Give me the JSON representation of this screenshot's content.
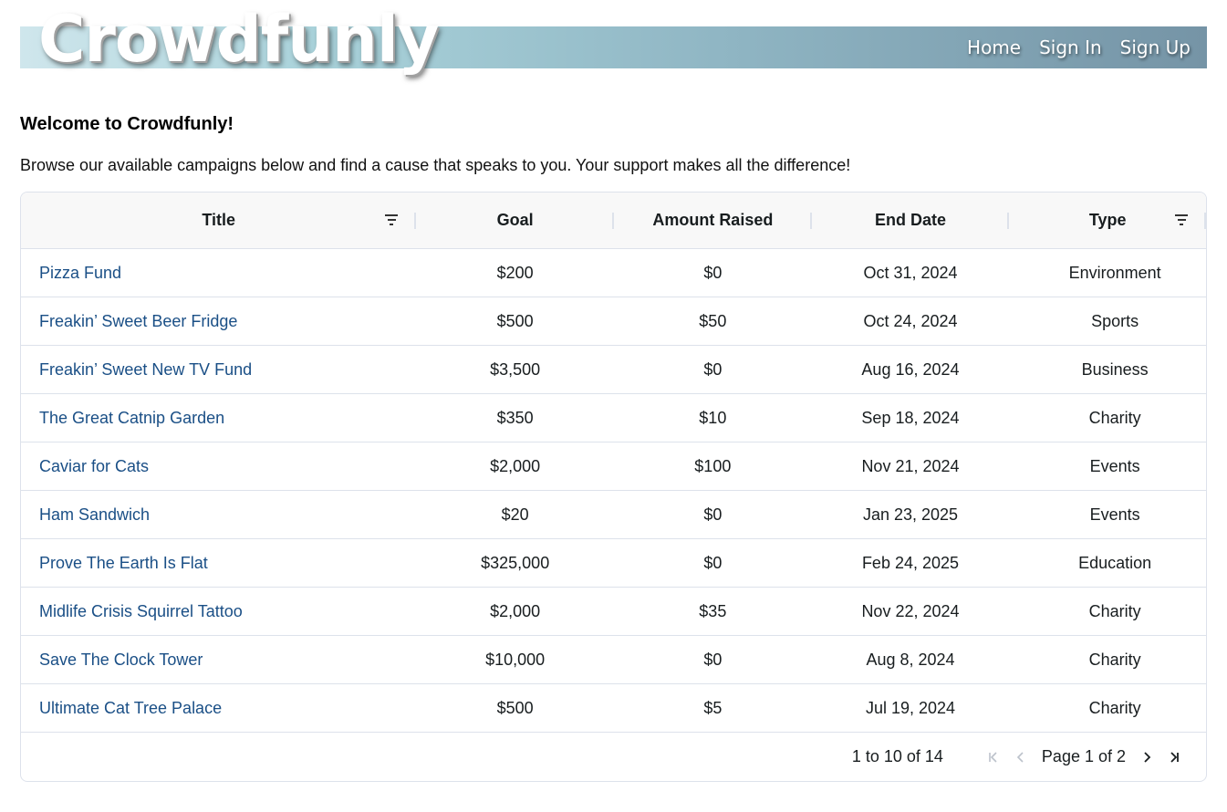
{
  "header": {
    "logo": "Crowdfunly",
    "nav": [
      {
        "label": "Home"
      },
      {
        "label": "Sign In"
      },
      {
        "label": "Sign Up"
      }
    ]
  },
  "welcome_title": "Welcome to Crowdfunly!",
  "intro_text": "Browse our available campaigns below and find a cause that speaks to you. Your support makes all the difference!",
  "table": {
    "columns": [
      "Title",
      "Goal",
      "Amount Raised",
      "End Date",
      "Type"
    ],
    "rows": [
      {
        "title": "Pizza Fund",
        "goal": "$200",
        "raised": "$0",
        "end": "Oct 31, 2024",
        "type": "Environment"
      },
      {
        "title": "Freakin’ Sweet Beer Fridge",
        "goal": "$500",
        "raised": "$50",
        "end": "Oct 24, 2024",
        "type": "Sports"
      },
      {
        "title": "Freakin’ Sweet New TV Fund",
        "goal": "$3,500",
        "raised": "$0",
        "end": "Aug 16, 2024",
        "type": "Business"
      },
      {
        "title": "The Great Catnip Garden",
        "goal": "$350",
        "raised": "$10",
        "end": "Sep 18, 2024",
        "type": "Charity"
      },
      {
        "title": "Caviar for Cats",
        "goal": "$2,000",
        "raised": "$100",
        "end": "Nov 21, 2024",
        "type": "Events"
      },
      {
        "title": "Ham Sandwich",
        "goal": "$20",
        "raised": "$0",
        "end": "Jan 23, 2025",
        "type": "Events"
      },
      {
        "title": "Prove The Earth Is Flat",
        "goal": "$325,000",
        "raised": "$0",
        "end": "Feb 24, 2025",
        "type": "Education"
      },
      {
        "title": "Midlife Crisis Squirrel Tattoo",
        "goal": "$2,000",
        "raised": "$35",
        "end": "Nov 22, 2024",
        "type": "Charity"
      },
      {
        "title": "Save The Clock Tower",
        "goal": "$10,000",
        "raised": "$0",
        "end": "Aug 8, 2024",
        "type": "Charity"
      },
      {
        "title": "Ultimate Cat Tree Palace",
        "goal": "$500",
        "raised": "$5",
        "end": "Jul 19, 2024",
        "type": "Charity"
      }
    ]
  },
  "pagination": {
    "range": "1 to 10 of 14",
    "page_label": "Page 1 of 2"
  },
  "colors": {
    "link": "#1a4f86",
    "banner_start": "#cfe6ec",
    "banner_end": "#7594a6"
  }
}
